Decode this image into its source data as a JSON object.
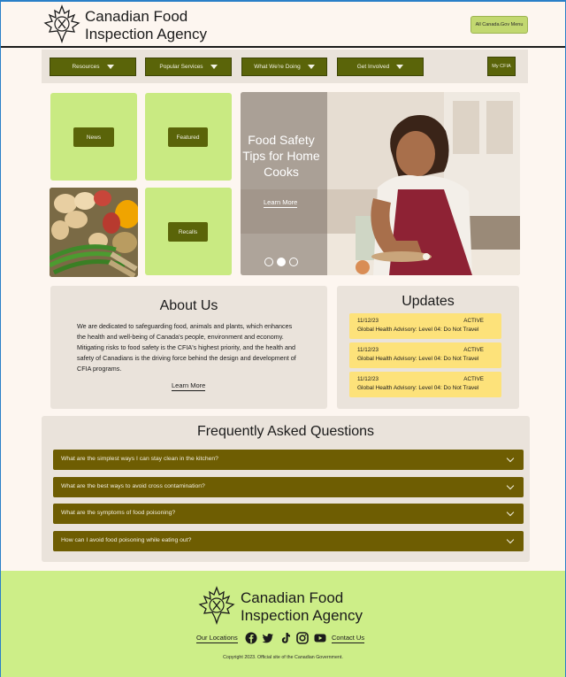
{
  "header": {
    "brand_line1": "Canadian Food",
    "brand_line2": "Inspection Agency",
    "gov_menu_label": "All Canada.Gov Menu"
  },
  "nav": {
    "items": [
      {
        "label": "Resources"
      },
      {
        "label": "Popular Services"
      },
      {
        "label": "What We're Doing"
      },
      {
        "label": "Get Involved"
      }
    ],
    "my_cfia_label": "My CFIA"
  },
  "tiles": {
    "news_label": "News",
    "featured_label": "Featured",
    "recalls_label": "Recalls"
  },
  "hero": {
    "title": "Food Safety Tips for Home Cooks",
    "link_label": "Learn More",
    "carousel_active_index": 1,
    "carousel_count": 3
  },
  "about": {
    "title": "About Us",
    "body": "We are dedicated to safeguarding food, animals and plants, which enhances the health and well-being of Canada's people, environment and economy. Mitigating risks to food safety is the CFIA's highest priority, and the health and safety of Canadians is the driving force behind the design and development of CFIA programs.",
    "link_label": "Learn More"
  },
  "updates": {
    "title": "Updates",
    "items": [
      {
        "date": "11/12/23",
        "status": "ACTIVE",
        "text": "Global Health Advisory: Level 04: Do Not Travel"
      },
      {
        "date": "11/12/23",
        "status": "ACTIVE",
        "text": "Global Health Advisory: Level 04: Do Not Travel"
      },
      {
        "date": "11/12/23",
        "status": "ACTIVE",
        "text": "Global Health Advisory: Level 04: Do Not Travel"
      }
    ]
  },
  "faq": {
    "title": "Frequently Asked Questions",
    "items": [
      {
        "question": "What are the simplest ways I can stay clean in the kitchen?"
      },
      {
        "question": "What are the best ways to avoid cross contamination?"
      },
      {
        "question": "What are the symptoms of food poisoning?"
      },
      {
        "question": "How can I avoid food poisoning while eating out?"
      }
    ]
  },
  "footer": {
    "brand_line1": "Canadian Food",
    "brand_line2": "Inspection Agency",
    "locations_label": "Our Locations",
    "contact_label": "Contact Us",
    "social_icons": [
      "facebook-icon",
      "twitter-icon",
      "tiktok-icon",
      "instagram-icon",
      "youtube-icon"
    ],
    "copyright": "Copyright 2023. Official site of the Canadian Government."
  },
  "colors": {
    "accent_dark": "#5a6409",
    "tile_green": "#c9ea82",
    "footer_green": "#cdee88",
    "faq_item": "#6e5d02",
    "update_yellow": "#fde27a",
    "panel": "#eae3db",
    "page_bg": "#fdf6f0"
  }
}
